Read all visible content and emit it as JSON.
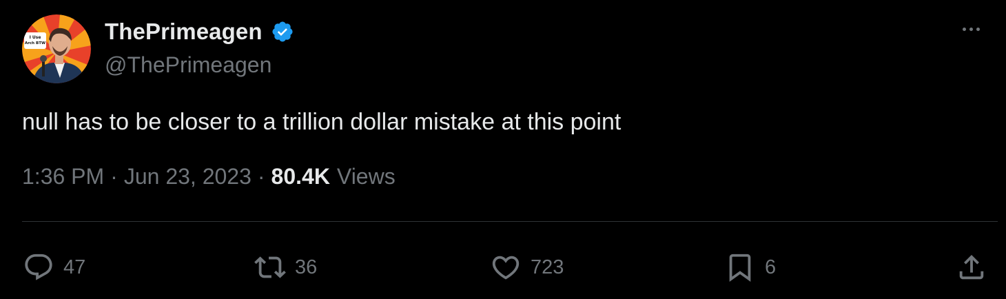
{
  "author": {
    "display_name": "ThePrimeagen",
    "handle": "@ThePrimeagen",
    "verified": true,
    "avatar_sign_text": "I Use Arch BTW"
  },
  "tweet": {
    "text": "null has to be closer to a trillion dollar mistake at this point"
  },
  "meta": {
    "time": "1:36 PM",
    "separator": "·",
    "date": "Jun 23, 2023",
    "views_count": "80.4K",
    "views_label": "Views"
  },
  "actions": {
    "reply_count": "47",
    "retweet_count": "36",
    "like_count": "723",
    "bookmark_count": "6"
  },
  "icons": {
    "reply": "speech-bubble-icon",
    "retweet": "retweet-arrows-icon",
    "like": "heart-icon",
    "bookmark": "bookmark-icon",
    "share": "share-upload-icon",
    "more": "more-horizontal-icon",
    "verified": "verified-badge-icon"
  },
  "colors": {
    "background": "#000000",
    "primary_text": "#e7e9ea",
    "secondary_text": "#71767b",
    "verified_blue": "#1d9bf0",
    "divider": "#2f3336"
  }
}
